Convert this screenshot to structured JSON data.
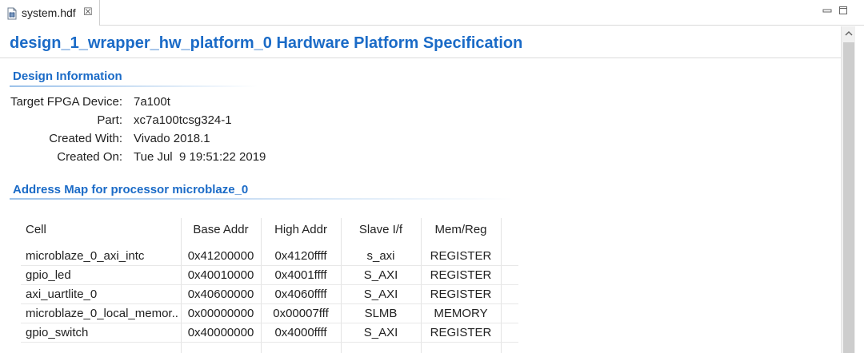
{
  "tab": {
    "label": "system.hdf",
    "close_glyph": "☒",
    "icon": "hardware-file-icon"
  },
  "window_controls": {
    "minimize_icon": "minimize-icon",
    "maximize_icon": "maximize-icon"
  },
  "page": {
    "title": "design_1_wrapper_hw_platform_0 Hardware Platform Specification"
  },
  "design_info": {
    "title": "Design Information",
    "rows": [
      {
        "key": "Target FPGA Device:",
        "value": "7a100t"
      },
      {
        "key": "Part:",
        "value": "xc7a100tcsg324-1"
      },
      {
        "key": "Created With:",
        "value": "Vivado 2018.1"
      },
      {
        "key": "Created On:",
        "value": "Tue Jul  9 19:51:22 2019"
      }
    ]
  },
  "address_map": {
    "title": "Address Map for processor microblaze_0",
    "columns": [
      "Cell",
      "Base Addr",
      "High Addr",
      "Slave I/f",
      "Mem/Reg"
    ],
    "rows": [
      [
        "microblaze_0_axi_intc",
        "0x41200000",
        "0x4120ffff",
        "s_axi",
        "REGISTER"
      ],
      [
        "gpio_led",
        "0x40010000",
        "0x4001ffff",
        "S_AXI",
        "REGISTER"
      ],
      [
        "axi_uartlite_0",
        "0x40600000",
        "0x4060ffff",
        "S_AXI",
        "REGISTER"
      ],
      [
        "microblaze_0_local_memor...",
        "0x00000000",
        "0x00007fff",
        "SLMB",
        "MEMORY"
      ],
      [
        "gpio_switch",
        "0x40000000",
        "0x4000ffff",
        "S_AXI",
        "REGISTER"
      ]
    ]
  },
  "colors": {
    "accent": "#1b6bc7",
    "text": "#222222",
    "scrollbar_thumb": "#cdcdcd"
  }
}
